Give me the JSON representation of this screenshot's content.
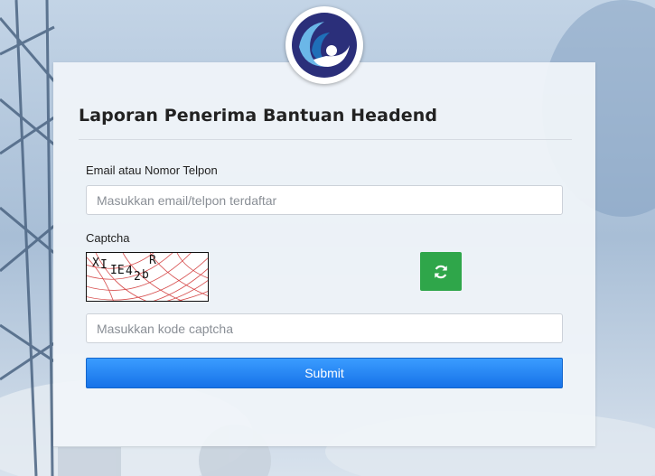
{
  "page": {
    "title": "Laporan Penerima Bantuan Headend"
  },
  "form": {
    "email_label": "Email atau Nomor Telpon",
    "email_placeholder": "Masukkan email/telpon terdaftar",
    "email_value": "",
    "captcha_label": "Captcha",
    "captcha_text": "XI IE4 2b R",
    "captcha_placeholder": "Masukkan kode captcha",
    "captcha_value": "",
    "submit_label": "Submit"
  },
  "icons": {
    "refresh": "refresh-icon",
    "logo": "kominfo-logo"
  },
  "colors": {
    "submit": "#1f7ff0",
    "refresh": "#2fa64a",
    "title": "#222222"
  }
}
